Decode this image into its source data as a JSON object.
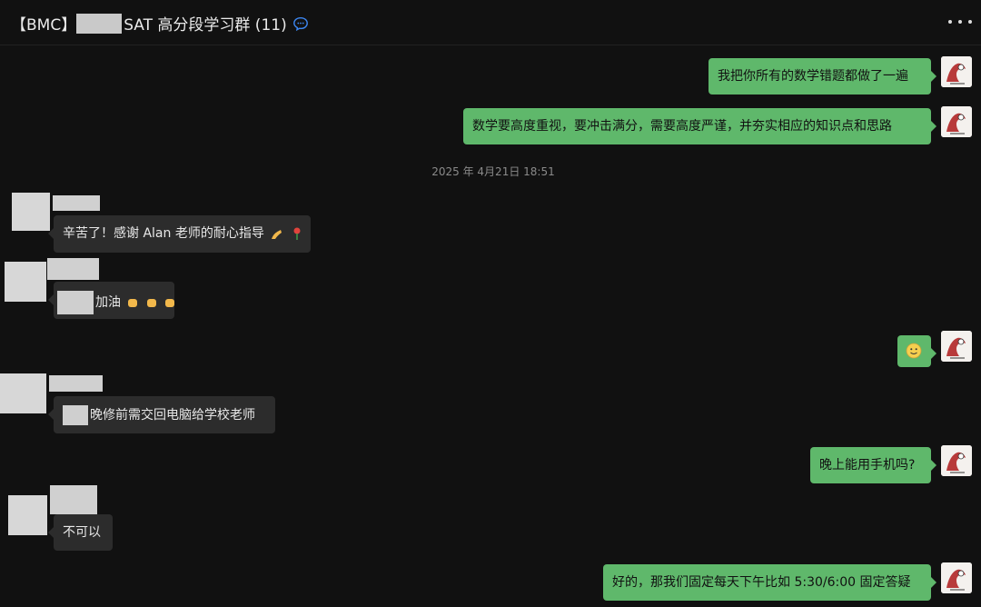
{
  "header": {
    "title_prefix": "【BMC】",
    "title_main": "SAT 高分段学习群 (11)",
    "chat_icon": "chat-bubble-icon",
    "more_icon": "more-dots-icon"
  },
  "timestamp": "2025 年 4月21日 18:51",
  "messages": {
    "m1": "我把你所有的数学错题都做了一遍",
    "m2": "数学要高度重视，要冲击满分，需要高度严谨，并夯实相应的知识点和思路",
    "m3": "辛苦了！感谢 Alan 老师的耐心指导",
    "m4": "加油",
    "m5_icon": "smile-emoji-icon",
    "m6": "晚修前需交回电脑给学校老师",
    "m7": "晚上能用手机吗?",
    "m8": "不可以",
    "m9": "好的，那我们固定每天下午比如 5:30/6:00 固定答疑"
  },
  "colors": {
    "background": "#111111",
    "my_bubble": "#5fb86b",
    "their_bubble": "#2c2c2c",
    "timestamp": "#8a8a8a"
  }
}
